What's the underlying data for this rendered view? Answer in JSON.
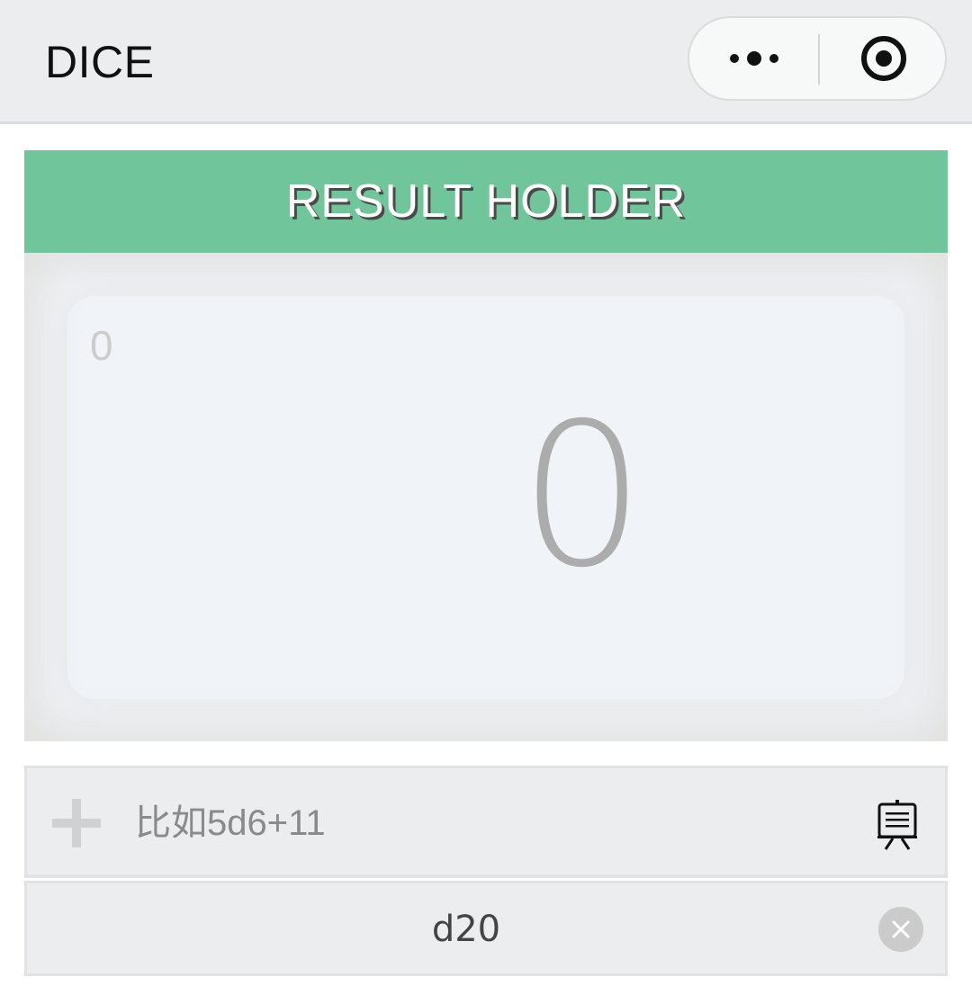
{
  "navbar": {
    "title": "DICE",
    "more_icon": "more-dots-icon",
    "close_icon": "target-close-icon"
  },
  "result_holder": {
    "header": "RESULT HOLDER",
    "small_value": "0",
    "big_value": "0"
  },
  "expression_input": {
    "placeholder": "比如5d6+11",
    "value": "",
    "add_icon": "plus-icon",
    "board_icon": "presentation-board-icon"
  },
  "dice_list": [
    {
      "label": "d20",
      "remove_icon": "clear-circle-icon"
    }
  ],
  "colors": {
    "accent": "#71c59a",
    "navbar_bg": "#ebedee",
    "result_bg": "#f0f3f8"
  }
}
